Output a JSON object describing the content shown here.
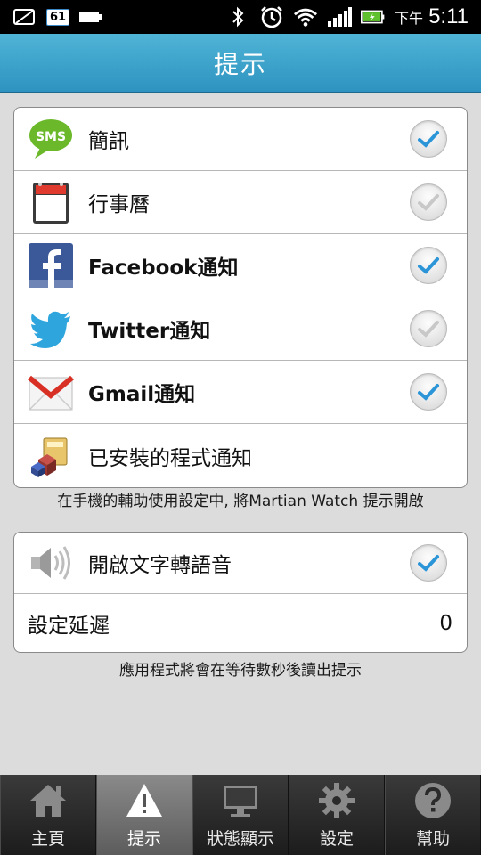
{
  "status_bar": {
    "badge": "61",
    "ampm": "下午",
    "time": "5:11"
  },
  "header": {
    "title": "提示"
  },
  "notifications": {
    "items": [
      {
        "label": "簡訊",
        "icon": "sms-icon",
        "checked": true
      },
      {
        "label": "行事曆",
        "icon": "calendar-icon",
        "checked": false
      },
      {
        "label": "Facebook通知",
        "icon": "facebook-icon",
        "checked": true
      },
      {
        "label": "Twitter通知",
        "icon": "twitter-icon",
        "checked": false
      },
      {
        "label": "Gmail通知",
        "icon": "gmail-icon",
        "checked": true
      },
      {
        "label": "已安裝的程式通知",
        "icon": "apps-icon"
      }
    ],
    "note": "在手機的輔助使用設定中, 將Martian Watch 提示開啟"
  },
  "tts": {
    "items": [
      {
        "label": "開啟文字轉語音",
        "icon": "speaker-icon",
        "checked": true
      },
      {
        "label": "設定延遲",
        "value": "0"
      }
    ],
    "note": "應用程式將會在等待數秒後讀出提示"
  },
  "tabs": [
    {
      "label": "主頁",
      "icon": "home-icon",
      "active": false
    },
    {
      "label": "提示",
      "icon": "warning-icon",
      "active": true
    },
    {
      "label": "狀態顯示",
      "icon": "monitor-icon",
      "active": false
    },
    {
      "label": "設定",
      "icon": "gear-icon",
      "active": false
    },
    {
      "label": "幫助",
      "icon": "help-icon",
      "active": false
    }
  ],
  "colors": {
    "header": "#3aa5cf",
    "check_on": "#2b95d8",
    "check_off": "#c8c8c8"
  }
}
